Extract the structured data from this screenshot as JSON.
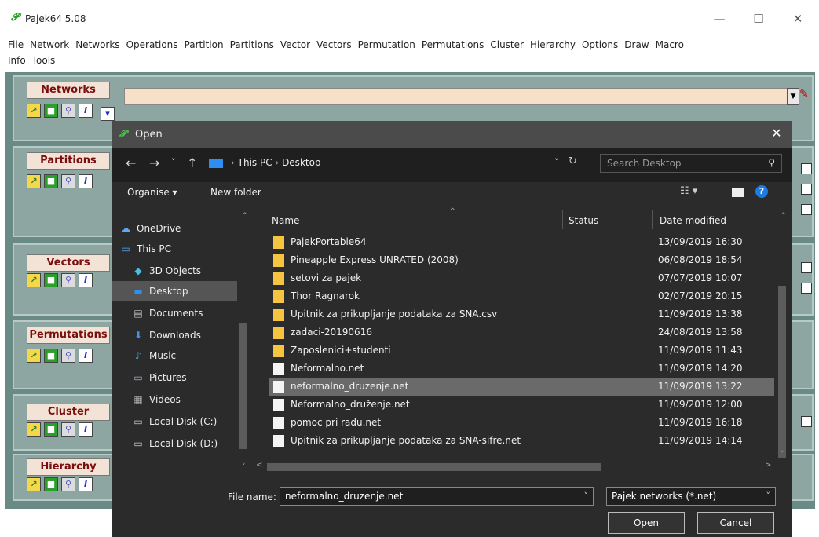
{
  "app": {
    "title": "Pajek64 5.08"
  },
  "window_controls": {
    "minimize": "—",
    "maximize": "☐",
    "close": "✕"
  },
  "menu": {
    "row1": [
      "File",
      "Network",
      "Networks",
      "Operations",
      "Partition",
      "Partitions",
      "Vector",
      "Vectors",
      "Permutation",
      "Permutations",
      "Cluster",
      "Hierarchy",
      "Options",
      "Draw",
      "Macro"
    ],
    "row2": [
      "Info",
      "Tools"
    ]
  },
  "panels": [
    {
      "label": "Networks"
    },
    {
      "label": "Partitions"
    },
    {
      "label": "Vectors"
    },
    {
      "label": "Permutations"
    },
    {
      "label": "Cluster"
    },
    {
      "label": "Hierarchy"
    }
  ],
  "dialog": {
    "title": "Open",
    "close": "✕",
    "breadcrumb": [
      "This PC",
      "Desktop"
    ],
    "search_placeholder": "Search Desktop",
    "toolbar": {
      "organise": "Organise ▾",
      "new_folder": "New folder"
    },
    "sidebar": [
      {
        "label": "OneDrive",
        "icon": "cloud-icon"
      },
      {
        "label": "This PC",
        "icon": "computer-icon"
      },
      {
        "label": "3D Objects",
        "icon": "cube-icon"
      },
      {
        "label": "Desktop",
        "icon": "desktop-icon",
        "selected": true
      },
      {
        "label": "Documents",
        "icon": "document-icon"
      },
      {
        "label": "Downloads",
        "icon": "download-icon"
      },
      {
        "label": "Music",
        "icon": "music-icon"
      },
      {
        "label": "Pictures",
        "icon": "picture-icon"
      },
      {
        "label": "Videos",
        "icon": "video-icon"
      },
      {
        "label": "Local Disk (C:)",
        "icon": "disk-icon"
      },
      {
        "label": "Local Disk (D:)",
        "icon": "disk-icon"
      }
    ],
    "columns": {
      "name": "Name",
      "status": "Status",
      "date": "Date modified"
    },
    "files": [
      {
        "name": "PajekPortable64",
        "date": "13/09/2019 16:30",
        "type": "folder"
      },
      {
        "name": "Pineapple Express UNRATED (2008)",
        "date": "06/08/2019 18:54",
        "type": "folder"
      },
      {
        "name": "setovi za pajek",
        "date": "07/07/2019 10:07",
        "type": "folder"
      },
      {
        "name": "Thor Ragnarok",
        "date": "02/07/2019 20:15",
        "type": "folder"
      },
      {
        "name": "Upitnik za prikupljanje podataka za SNA.csv",
        "date": "11/09/2019 13:38",
        "type": "folder"
      },
      {
        "name": "zadaci-20190616",
        "date": "24/08/2019 13:58",
        "type": "folder"
      },
      {
        "name": "Zaposlenici+studenti",
        "date": "11/09/2019 11:43",
        "type": "folder"
      },
      {
        "name": "Neformalno.net",
        "date": "11/09/2019 14:20",
        "type": "file"
      },
      {
        "name": "neformalno_druzenje.net",
        "date": "11/09/2019 13:22",
        "type": "file",
        "selected": true
      },
      {
        "name": "Neformalno_druženje.net",
        "date": "11/09/2019 12:00",
        "type": "file"
      },
      {
        "name": "pomoc pri radu.net",
        "date": "11/09/2019 16:18",
        "type": "file"
      },
      {
        "name": "Upitnik za prikupljanje podataka za SNA-sifre.net",
        "date": "11/09/2019 14:14",
        "type": "file"
      }
    ],
    "file_name_label": "File name:",
    "file_name_value": "neformalno_druzenje.net",
    "file_type_value": "Pajek networks (*.net)",
    "open_button": "Open",
    "cancel_button": "Cancel"
  }
}
